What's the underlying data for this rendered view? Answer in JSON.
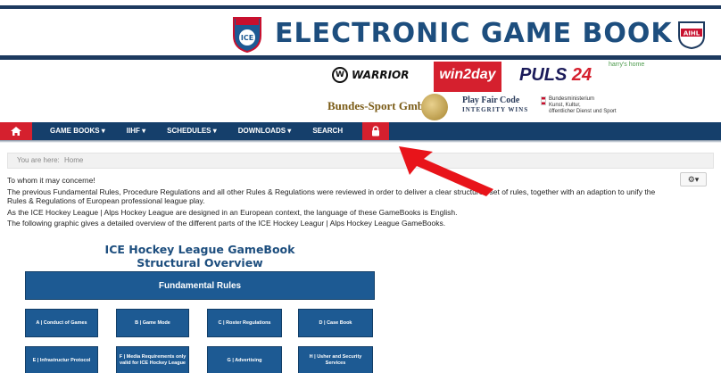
{
  "header": {
    "title": "ELECTRONIC GAME BOOK",
    "ice_logo_text": "ICE",
    "aihl_logo_text": "AIHL"
  },
  "sponsors": {
    "warrior": "WARRIOR",
    "win2day": "win2day",
    "puls_text": "PULS",
    "puls_num": "24",
    "harrys": "harry's home",
    "bundes_sport": "Bundes-Sport GmbH",
    "fair_play_line1": "Play Fair Code",
    "fair_play_line2": "INTEGRITY WINS",
    "ministry_line1": "Bundesministerium",
    "ministry_line2": "Kunst, Kultur,",
    "ministry_line3": "öffentlicher Dienst und Sport"
  },
  "nav": {
    "items": [
      {
        "label": "GAME BOOKS ▾"
      },
      {
        "label": "IIHF ▾"
      },
      {
        "label": "SCHEDULES ▾"
      },
      {
        "label": "DOWNLOADS ▾"
      },
      {
        "label": "SEARCH"
      }
    ]
  },
  "breadcrumb": {
    "prefix": "You are here:",
    "home": "Home"
  },
  "gear": {
    "label": "⚙▾"
  },
  "content": {
    "p1": "To whom it may concerne!",
    "p2": "The previous Fundamental Rules, Procedure Regulations and all other Rules & Regulations were reviewed in order to deliver a clear structured set of rules, together with an adaption to unify the Rules & Regulations of European professional league play.",
    "p3": "As the ICE Hockey League | Alps Hockey League are designed in an European context, the language of these GameBooks is English.",
    "p4": "The following graphic gives a detailed overview of the different parts of the ICE Hockey Leagur | Alps Hockey League GameBooks."
  },
  "diagram": {
    "title_line1": "ICE Hockey League GameBook",
    "title_line2": "Structural Overview",
    "fundamental": "Fundamental Rules",
    "row1": [
      "A | Conduct of Games",
      "B | Game Mode",
      "C | Roster Regulations",
      "D | Case Book"
    ],
    "row2": [
      "E | Infrastructur Protocol",
      "F | Media Requirements only valid for ICE Hockey League",
      "G | Advertising",
      "H | Usher and Security Services"
    ]
  },
  "colors": {
    "brand_navy": "#153f6b",
    "accent_red": "#d5202e",
    "diagram_blue": "#1d5a93"
  }
}
